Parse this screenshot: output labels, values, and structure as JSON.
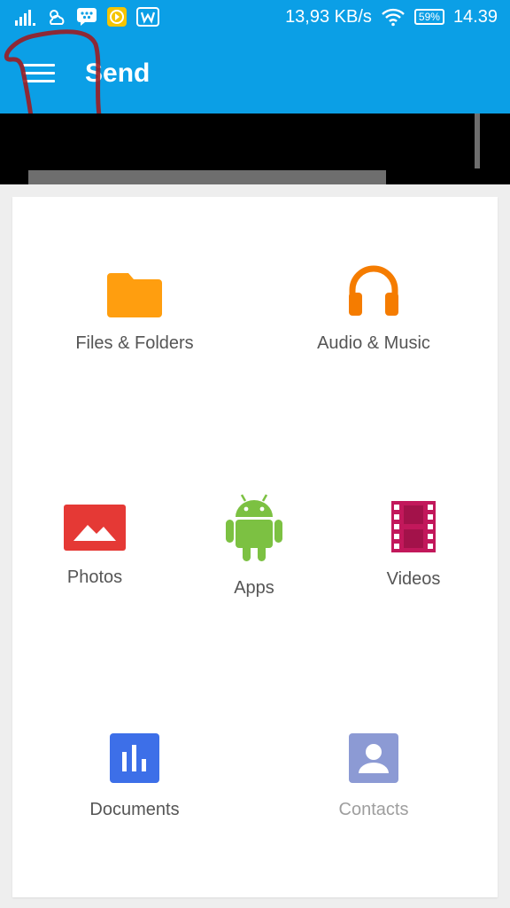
{
  "status_bar": {
    "speed": "13,93 KB/s",
    "battery": "59%",
    "time": "14.39"
  },
  "app_bar": {
    "title": "Send"
  },
  "categories": [
    {
      "label": "Files & Folders",
      "icon": "folder-icon",
      "color": "#ff9e0f"
    },
    {
      "label": "Audio & Music",
      "icon": "headphones-icon",
      "color": "#f57c00"
    },
    {
      "label": "Photos",
      "icon": "photo-icon",
      "color": "#e53935"
    },
    {
      "label": "Apps",
      "icon": "android-icon",
      "color": "#7cc142"
    },
    {
      "label": "Videos",
      "icon": "film-icon",
      "color": "#c2185b"
    },
    {
      "label": "Documents",
      "icon": "bar-chart-icon",
      "color": "#3d6fe8"
    },
    {
      "label": "Contacts",
      "icon": "contact-icon",
      "color": "#8c9ad4"
    }
  ],
  "colors": {
    "app_bar": "#0b9fe6",
    "annotation": "#9b1c22"
  }
}
